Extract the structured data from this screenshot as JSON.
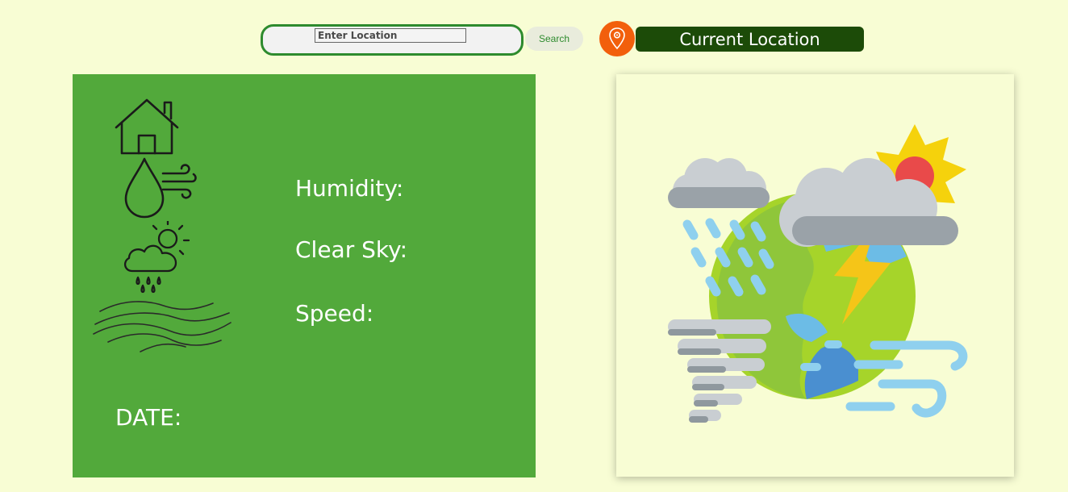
{
  "search": {
    "placeholder": "Enter Location",
    "button_label": "Search"
  },
  "location": {
    "icon": "location-pin-icon",
    "button_label": "Current Location",
    "icon_color": "#f25f0c",
    "button_color": "#1c4b08"
  },
  "weather_card": {
    "background_color": "#52a93b",
    "icons": [
      "home-icon",
      "humidity-wind-icon",
      "rain-cloud-sun-icon",
      "wind-waves-icon"
    ],
    "humidity_label": "Humidity:",
    "sky_label": "Clear Sky:",
    "speed_label": "Speed:",
    "date_label": "DATE:"
  },
  "illustration": {
    "icon": "weather-globe-illustration"
  },
  "colors": {
    "page_background": "#f8fdd4",
    "accent_green": "#2e8b2e"
  }
}
